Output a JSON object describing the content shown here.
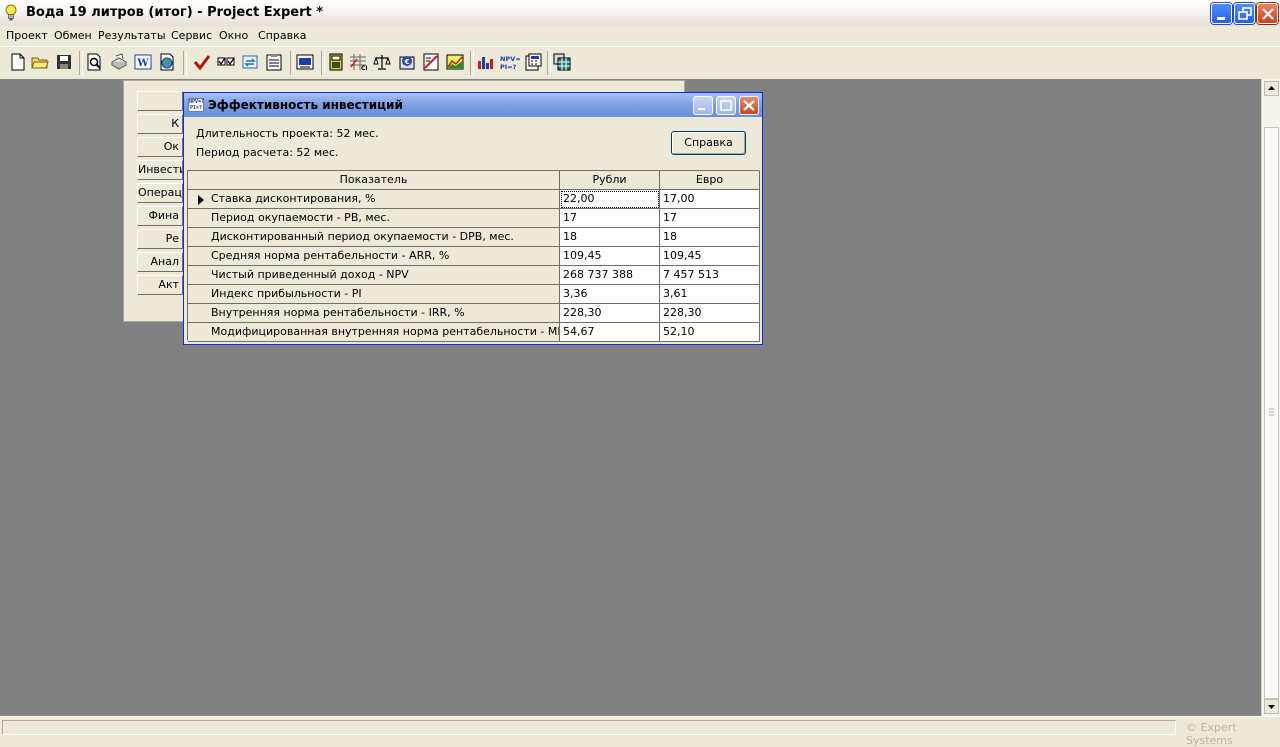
{
  "window": {
    "title": "Вода 19 литров (итог) - Project Expert *"
  },
  "menu": {
    "items": [
      {
        "label": "Проект"
      },
      {
        "label": "Обмен"
      },
      {
        "label": "Результаты"
      },
      {
        "label": "Сервис"
      },
      {
        "label": "Окно"
      },
      {
        "label": "Справка"
      }
    ]
  },
  "toolbar": {
    "icons": [
      "new-document-icon",
      "open-folder-icon",
      "save-icon",
      "print-preview-icon",
      "print-icon",
      "word-export-icon",
      "web-export-icon",
      "check-icon",
      "checkbox-list-icon",
      "refresh-icon",
      "clipboard-list-icon",
      "report-icon",
      "table-icon",
      "cash-flow-icon",
      "scales-icon",
      "currency-icon",
      "chart-icon",
      "graph-icon",
      "bar-chart-icon",
      "npv-pi-icon",
      "calculator-icon",
      "data-grid-icon"
    ]
  },
  "nav": {
    "buttons": [
      {
        "label": ""
      },
      {
        "label": "К"
      },
      {
        "label": "Ок"
      },
      {
        "label": "Инвести"
      },
      {
        "label": "Операц"
      },
      {
        "label": "Фина"
      },
      {
        "label": "Ре"
      },
      {
        "label": "Анал"
      },
      {
        "label": "Акт"
      }
    ]
  },
  "dialog": {
    "title": "Эффективность инвестиций",
    "icon_text": "NPV=? PI=?",
    "project_duration": "Длительность проекта: 52 мес.",
    "calc_period": "Период расчета: 52 мес.",
    "help_button": "Справка",
    "columns": {
      "indicator": "Показатель",
      "rub": "Рубли",
      "eur": "Евро"
    },
    "rows": [
      {
        "label": "Ставка дисконтирования, %",
        "rub": "22,00",
        "eur": "17,00"
      },
      {
        "label": "Период окупаемости - PB, мес.",
        "rub": "17",
        "eur": "17"
      },
      {
        "label": "Дисконтированный период окупаемости - DPB, мес.",
        "rub": "18",
        "eur": "18"
      },
      {
        "label": "Средняя норма рентабельности - ARR, %",
        "rub": "109,45",
        "eur": "109,45"
      },
      {
        "label": "Чистый приведенный доход - NPV",
        "rub": "268 737 388",
        "eur": "7 457 513"
      },
      {
        "label": "Индекс прибыльности - PI",
        "rub": "3,36",
        "eur": "3,61"
      },
      {
        "label": "Внутренняя норма рентабельности - IRR, %",
        "rub": "228,30",
        "eur": "228,30"
      },
      {
        "label": "Модифицированная внутренняя норма рентабельности - MIRR, %",
        "rub": "54,67",
        "eur": "52,10"
      }
    ]
  },
  "status": {
    "copyright": "© Expert Systems"
  }
}
